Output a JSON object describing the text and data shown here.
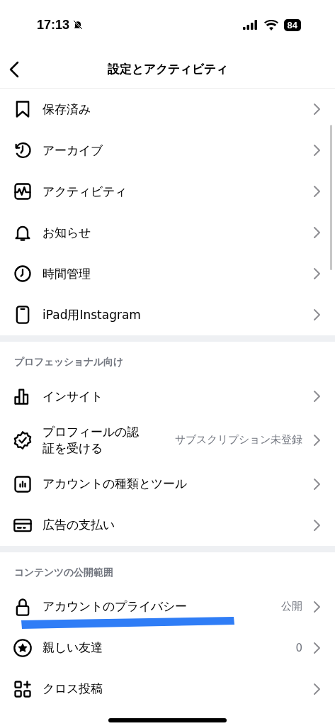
{
  "status_bar": {
    "time": "17:13",
    "battery": "84"
  },
  "header": {
    "title": "設定とアクティビティ"
  },
  "sections": [
    {
      "items": [
        {
          "label": "保存済み"
        },
        {
          "label": "アーカイブ"
        },
        {
          "label": "アクティビティ"
        },
        {
          "label": "お知らせ"
        },
        {
          "label": "時間管理"
        },
        {
          "label": "iPad用Instagram"
        }
      ]
    },
    {
      "title": "プロフェッショナル向け",
      "items": [
        {
          "label": "インサイト"
        },
        {
          "label": "プロフィールの認証を受ける",
          "value": "サブスクリプション未登録"
        },
        {
          "label": "アカウントの種類とツール"
        },
        {
          "label": "広告の支払い"
        }
      ]
    },
    {
      "title": "コンテンツの公開範囲",
      "items": [
        {
          "label": "アカウントのプライバシー",
          "value": "公開"
        },
        {
          "label": "親しい友達",
          "value": "0"
        },
        {
          "label": "クロス投稿"
        }
      ]
    }
  ]
}
